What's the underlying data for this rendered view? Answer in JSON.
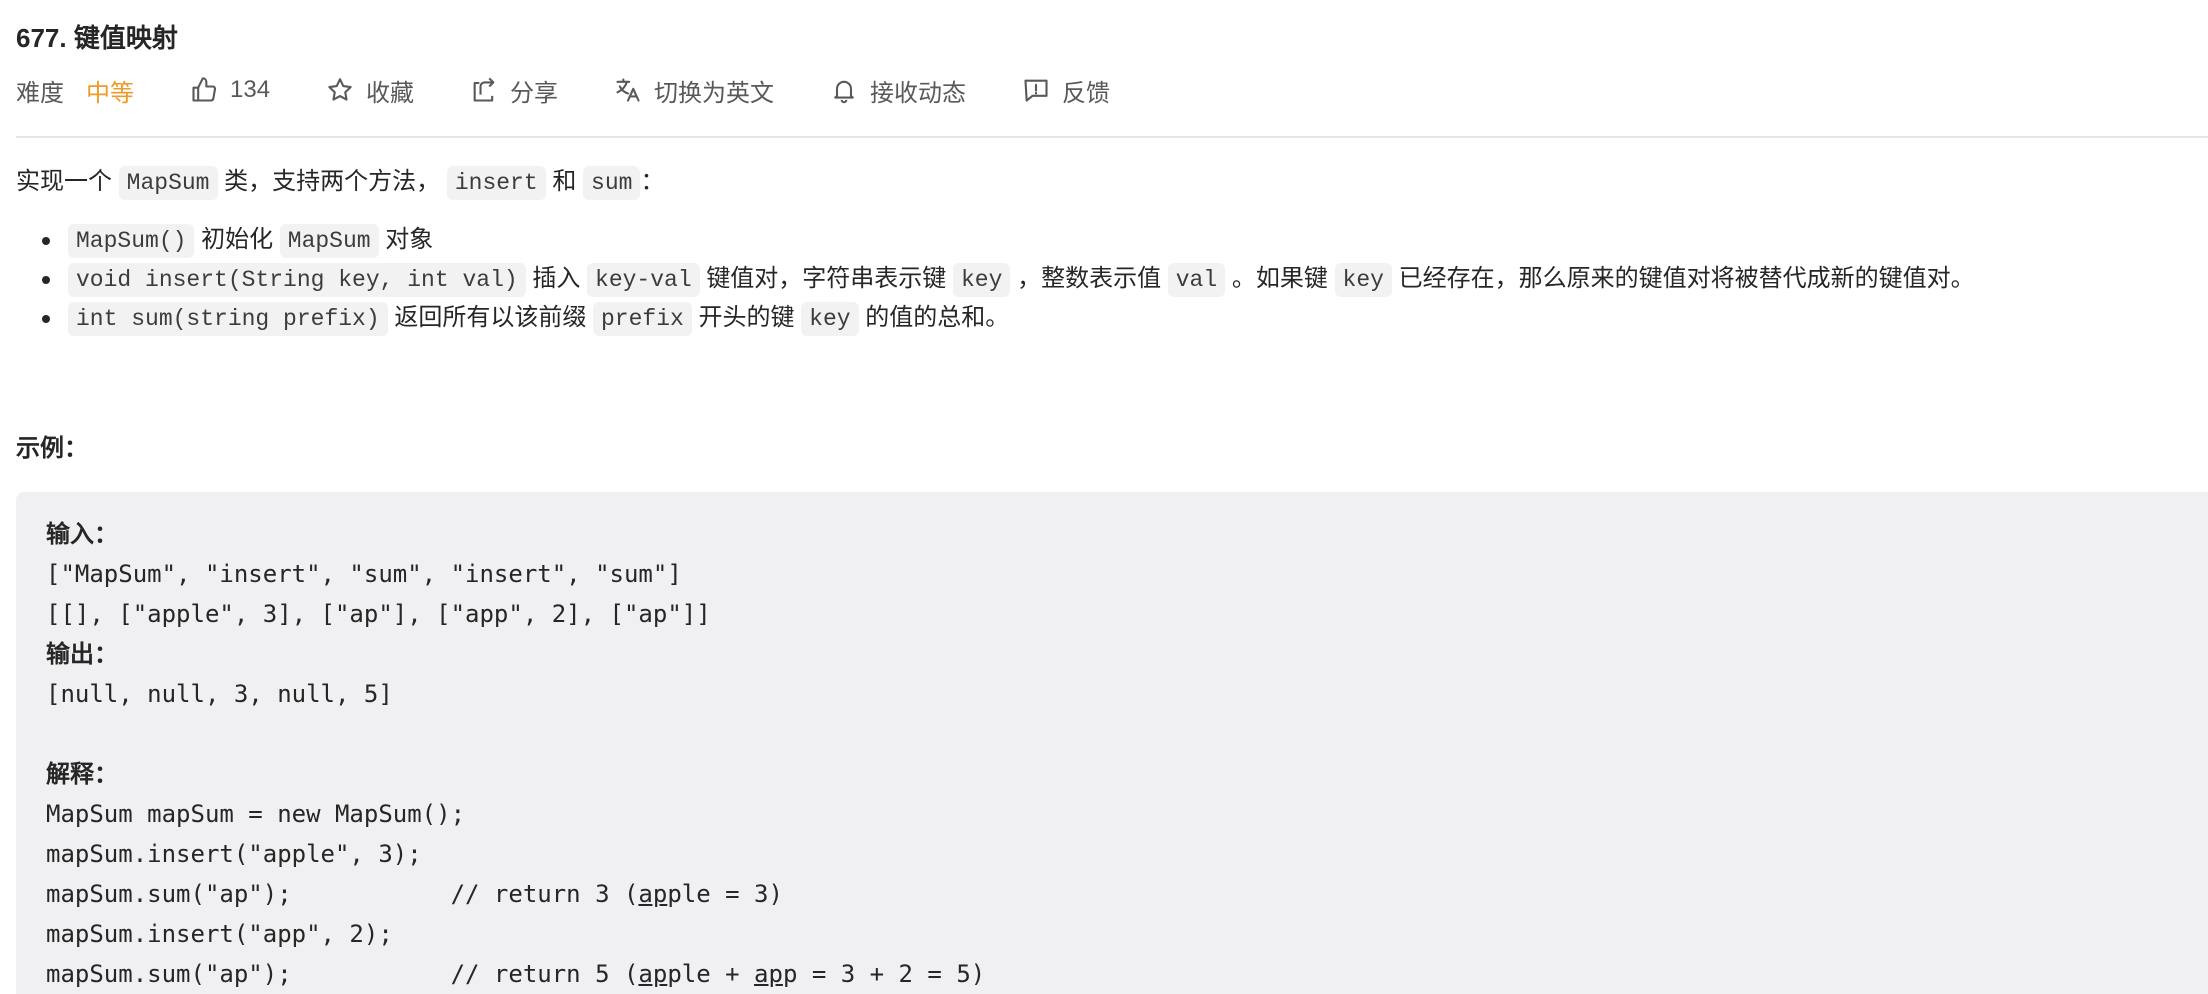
{
  "problem": {
    "title": "677. 键值映射"
  },
  "toolbar": {
    "difficulty_label": "难度",
    "difficulty_value": "中等",
    "likes": "134",
    "favorite": "收藏",
    "share": "分享",
    "switch_lang": "切换为英文",
    "notifications": "接收动态",
    "feedback": "反馈",
    "colors": {
      "difficulty_medium": "#ef9b2a"
    }
  },
  "description": {
    "intro": {
      "p1": "实现一个",
      "c1": "MapSum",
      "p2": "类，支持两个方法，",
      "c2": "insert",
      "p3": "和",
      "c3": "sum",
      "p4": "："
    },
    "items": [
      {
        "code1": "MapSum()",
        "text1": "初始化",
        "code2": "MapSum",
        "text2": "对象"
      },
      {
        "code1": "void insert(String key, int val)",
        "text1": "插入",
        "code2": "key-val",
        "text2": "键值对，字符串表示键",
        "code3": "key",
        "text3": "，整数表示值",
        "code4": "val",
        "text4": "。如果键",
        "code5": "key",
        "text5": "已经存在，那么原来的键值对将被替代成新的键值对。"
      },
      {
        "code1": "int sum(string prefix)",
        "text1": "返回所有以该前缀",
        "code2": "prefix",
        "text2": "开头的键",
        "code3": "key",
        "text3": "的值的总和。"
      }
    ]
  },
  "example": {
    "heading": "示例：",
    "input_label": "输入：",
    "input_line1": "[\"MapSum\", \"insert\", \"sum\", \"insert\", \"sum\"]",
    "input_line2": "[[], [\"apple\", 3], [\"ap\"], [\"app\", 2], [\"ap\"]]",
    "output_label": "输出：",
    "output_line": "[null, null, 3, null, 5]",
    "explain_label": "解释：",
    "line1": "MapSum mapSum = new MapSum();",
    "line2": "mapSum.insert(\"apple\", 3);",
    "line3_code": "mapSum.sum(\"ap\");           // return 3 (",
    "line3_u": "ap",
    "line3_rest": "ple = 3)",
    "line4": "mapSum.insert(\"app\", 2);",
    "line5_code": "mapSum.sum(\"ap\");           // return 5 (",
    "line5_u1": "ap",
    "line5_mid": "ple + ",
    "line5_u2": "ap",
    "line5_mid2": "p",
    "line5_rest": " = 3 + 2 = 5)"
  }
}
